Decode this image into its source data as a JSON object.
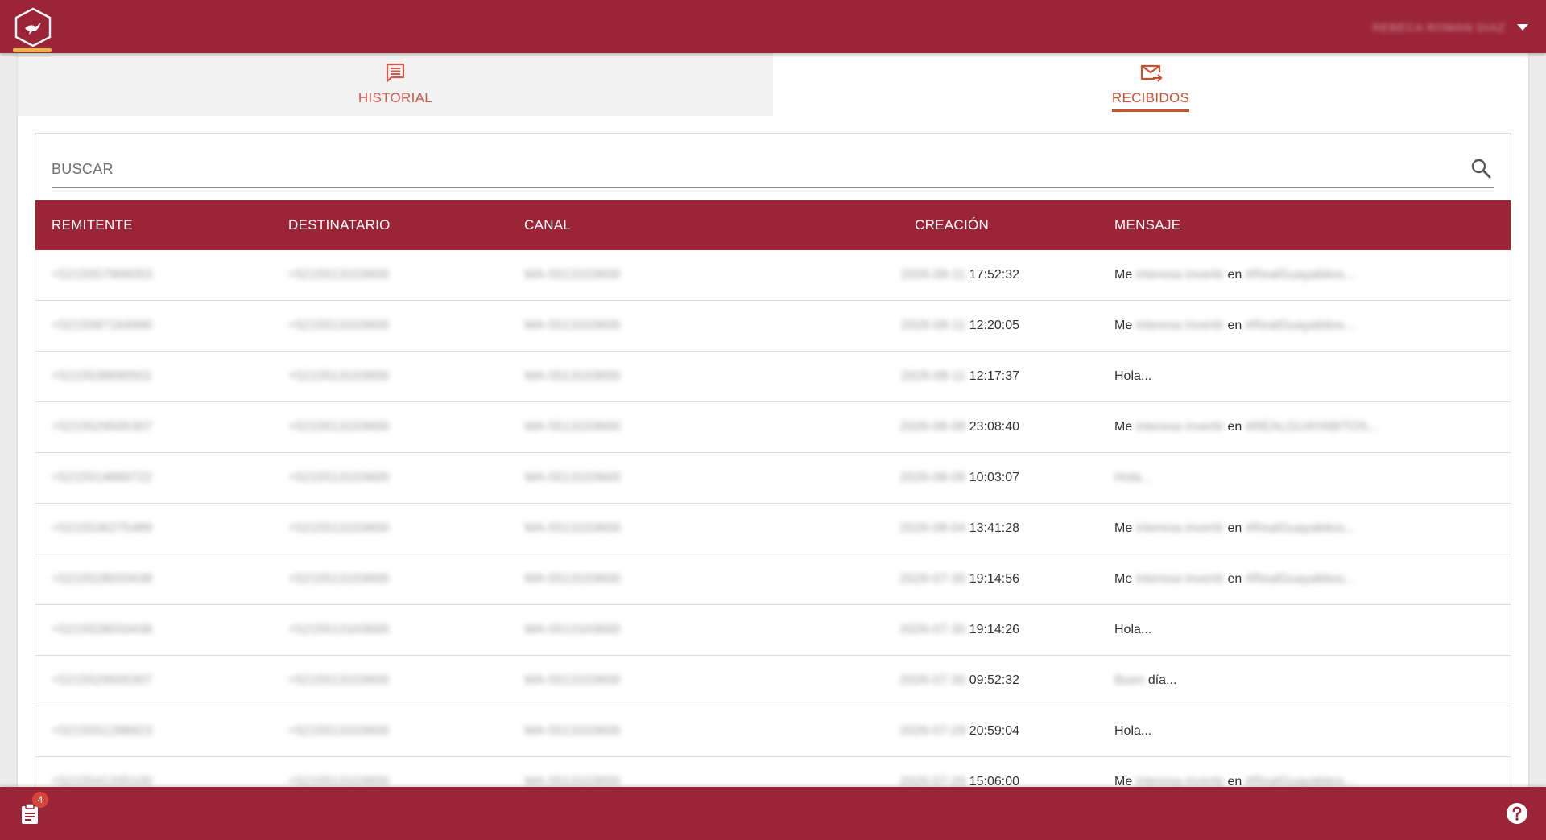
{
  "header": {
    "user_name": "REBECA ROMAN DIAZ",
    "menu_icon": "caret-down-icon",
    "logo_icon": "hexagon-hummingbird-logo"
  },
  "tabs": [
    {
      "label": "HISTORIAL",
      "icon": "chat-icon",
      "active": false
    },
    {
      "label": "RECIBIDOS",
      "icon": "mail-forward-icon",
      "active": true
    }
  ],
  "search": {
    "placeholder": "BUSCAR"
  },
  "table": {
    "columns": [
      "REMITENTE",
      "DESTINATARIO",
      "CANAL",
      "CREACIÓN",
      "MENSAJE"
    ],
    "rows": [
      {
        "remitente": "+5215557966053",
        "destinatario": "+5215513103600",
        "canal": "WA-5513103600",
        "fecha": "2026-08-11",
        "hora": "17:52:32",
        "msg": [
          "Me",
          "interesa invertir",
          "en",
          "#RealGuayabitos..."
        ]
      },
      {
        "remitente": "+5215587164990",
        "destinatario": "+5215513103600",
        "canal": "WA-5513103600",
        "fecha": "2026-08-11",
        "hora": "12:20:05",
        "msg": [
          "Me",
          "interesa invertir",
          "en",
          "#RealGuayabitos..."
        ]
      },
      {
        "remitente": "+5215538690501",
        "destinatario": "+5215513103600",
        "canal": "WA-5513103600",
        "fecha": "2026-08-11",
        "hora": "12:17:37",
        "msg": [
          "Hola..."
        ]
      },
      {
        "remitente": "+5215529505307",
        "destinatario": "+5215513103600",
        "canal": "WA-5513103600",
        "fecha": "2026-08-08",
        "hora": "23:08:40",
        "msg": [
          "Me",
          "interesa invertir",
          "en",
          "#REALGUAYABITOS..."
        ]
      },
      {
        "remitente": "+5215514889722",
        "destinatario": "+5215513103600",
        "canal": "WA-5513103600",
        "fecha": "2026-08-06",
        "hora": "10:03:07",
        "msg": [
          "",
          "Hola..."
        ]
      },
      {
        "remitente": "+5215536275489",
        "destinatario": "+5215513103600",
        "canal": "WA-5513103600",
        "fecha": "2026-08-04",
        "hora": "13:41:28",
        "msg": [
          "Me",
          "interesa invertir",
          "en",
          "#RealGuayabitos..."
        ]
      },
      {
        "remitente": "+5215528033438",
        "destinatario": "+5215513103600",
        "canal": "WA-5513103600",
        "fecha": "2026-07-30",
        "hora": "19:14:56",
        "msg": [
          "Me",
          "interesa invertir",
          "en",
          "#RealGuayabitos..."
        ]
      },
      {
        "remitente": "+5215528033438",
        "destinatario": "+5215513103600",
        "canal": "WA-5513103600",
        "fecha": "2026-07-30",
        "hora": "19:14:26",
        "msg": [
          "Hola..."
        ]
      },
      {
        "remitente": "+5215529505307",
        "destinatario": "+5215513103600",
        "canal": "WA-5513103600",
        "fecha": "2026-07-30",
        "hora": "09:52:32",
        "msg": [
          "",
          "Buen",
          "día..."
        ]
      },
      {
        "remitente": "+5215551288823",
        "destinatario": "+5215513103600",
        "canal": "WA-5513103600",
        "fecha": "2026-07-29",
        "hora": "20:59:04",
        "msg": [
          "Hola..."
        ]
      },
      {
        "remitente": "+5215541335100",
        "destinatario": "+5215513103600",
        "canal": "WA-5513103600",
        "fecha": "2026-07-29",
        "hora": "15:06:00",
        "msg": [
          "Me",
          "interesa invertir",
          "en",
          "#RealGuayabitos..."
        ]
      }
    ]
  },
  "footer": {
    "clipboard_icon": "clipboard-icon",
    "badge_count": "4",
    "help_icon": "help-icon"
  },
  "colors": {
    "brand": "#9b2537",
    "accent": "#c9502f",
    "logo_underline": "#e7b54a"
  }
}
